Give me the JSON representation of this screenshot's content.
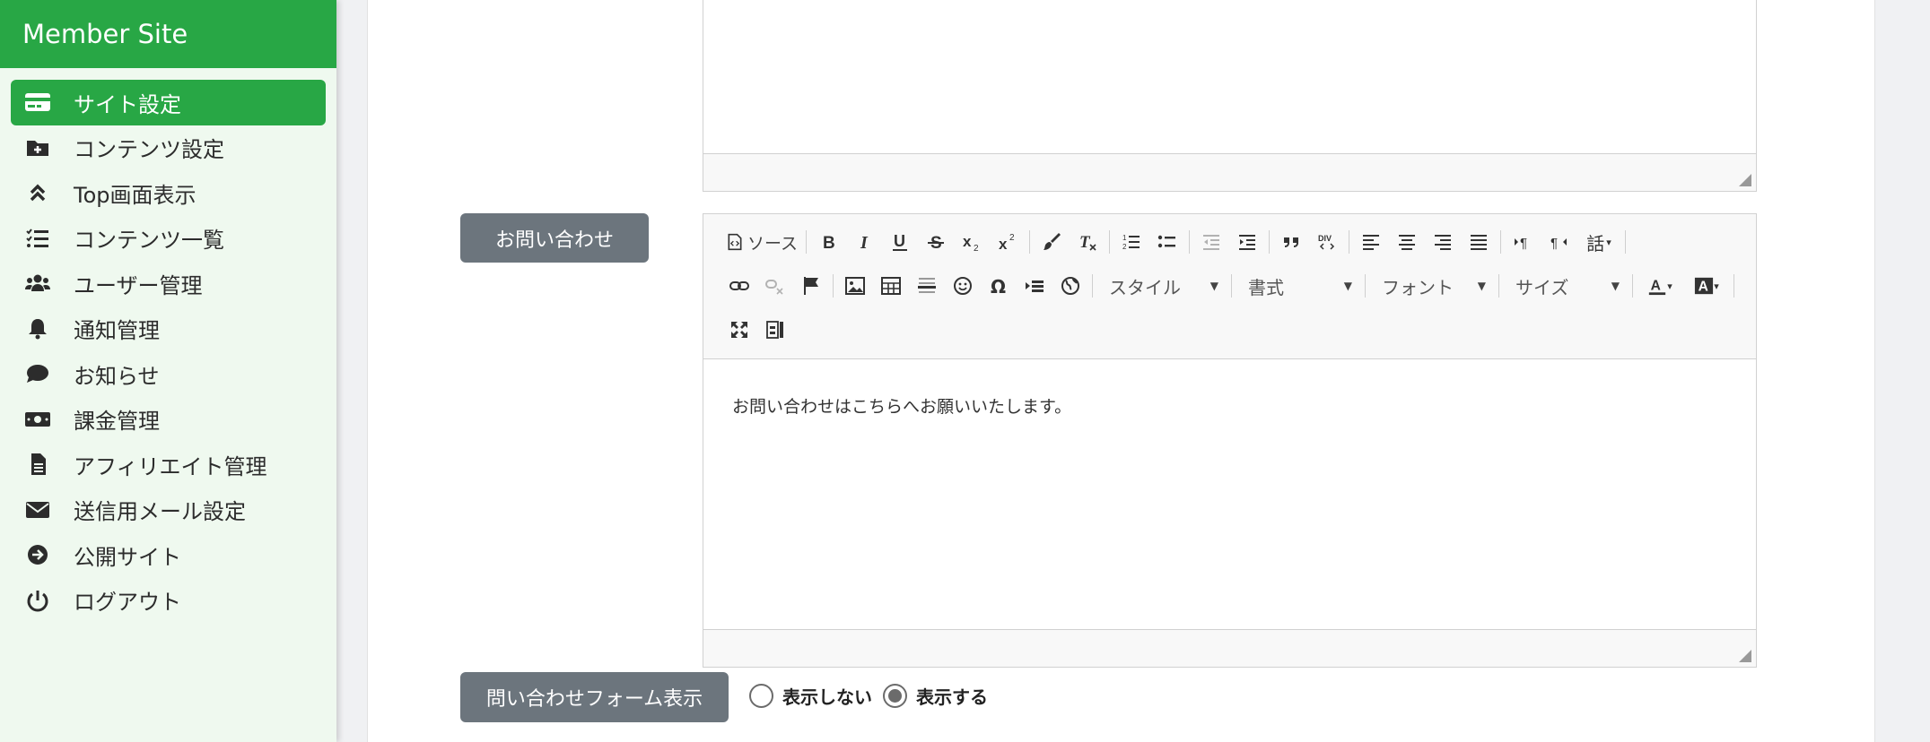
{
  "app": {
    "brand": "Member Site"
  },
  "sidebar": {
    "items": [
      {
        "label": "サイト設定",
        "icon": "credit-card-icon",
        "active": true
      },
      {
        "label": "コンテンツ設定",
        "icon": "folder-plus-icon",
        "active": false
      },
      {
        "label": "Top画面表示",
        "icon": "angle-double-up-icon",
        "active": false
      },
      {
        "label": "コンテンツ一覧",
        "icon": "tasks-icon",
        "active": false
      },
      {
        "label": "ユーザー管理",
        "icon": "users-icon",
        "active": false
      },
      {
        "label": "通知管理",
        "icon": "bell-icon",
        "active": false
      },
      {
        "label": "お知らせ",
        "icon": "comment-icon",
        "active": false
      },
      {
        "label": "課金管理",
        "icon": "money-bill-icon",
        "active": false
      },
      {
        "label": "アフィリエイト管理",
        "icon": "file-alt-icon",
        "active": false
      },
      {
        "label": "送信用メール設定",
        "icon": "envelope-icon",
        "active": false
      },
      {
        "label": "公開サイト",
        "icon": "arrow-circle-right-icon",
        "active": false
      },
      {
        "label": "ログアウト",
        "icon": "power-off-icon",
        "active": false
      }
    ]
  },
  "main": {
    "contact_section": {
      "label": "お問い合わせ",
      "editor": {
        "toolbar": {
          "source_label": "ソース",
          "lang_label": "話",
          "style_combo": "スタイル",
          "format_combo": "書式",
          "font_combo": "フォント",
          "size_combo": "サイズ"
        },
        "content": "お問い合わせはこちらへお願いいたします。"
      }
    },
    "form_display": {
      "label": "問い合わせフォーム表示",
      "options": [
        {
          "label": "表示しない",
          "selected": false
        },
        {
          "label": "表示する",
          "selected": true
        }
      ]
    }
  },
  "colors": {
    "brand": "#28a745",
    "sidebar_bg": "#eff9ef",
    "label_button": "#6c757d"
  }
}
